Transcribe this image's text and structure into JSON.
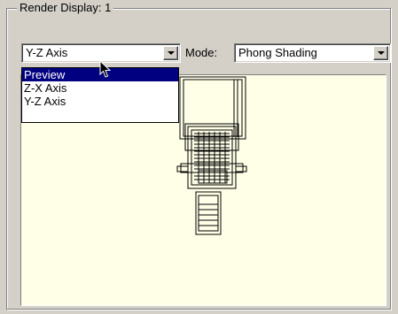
{
  "group": {
    "title": "Render Display: 1"
  },
  "axis_select": {
    "value": "Y-Z Axis",
    "options": [
      "Preview",
      "Z-X Axis",
      "Y-Z Axis"
    ],
    "highlighted": "Preview"
  },
  "mode": {
    "label": "Mode:",
    "value": "Phong Shading"
  }
}
